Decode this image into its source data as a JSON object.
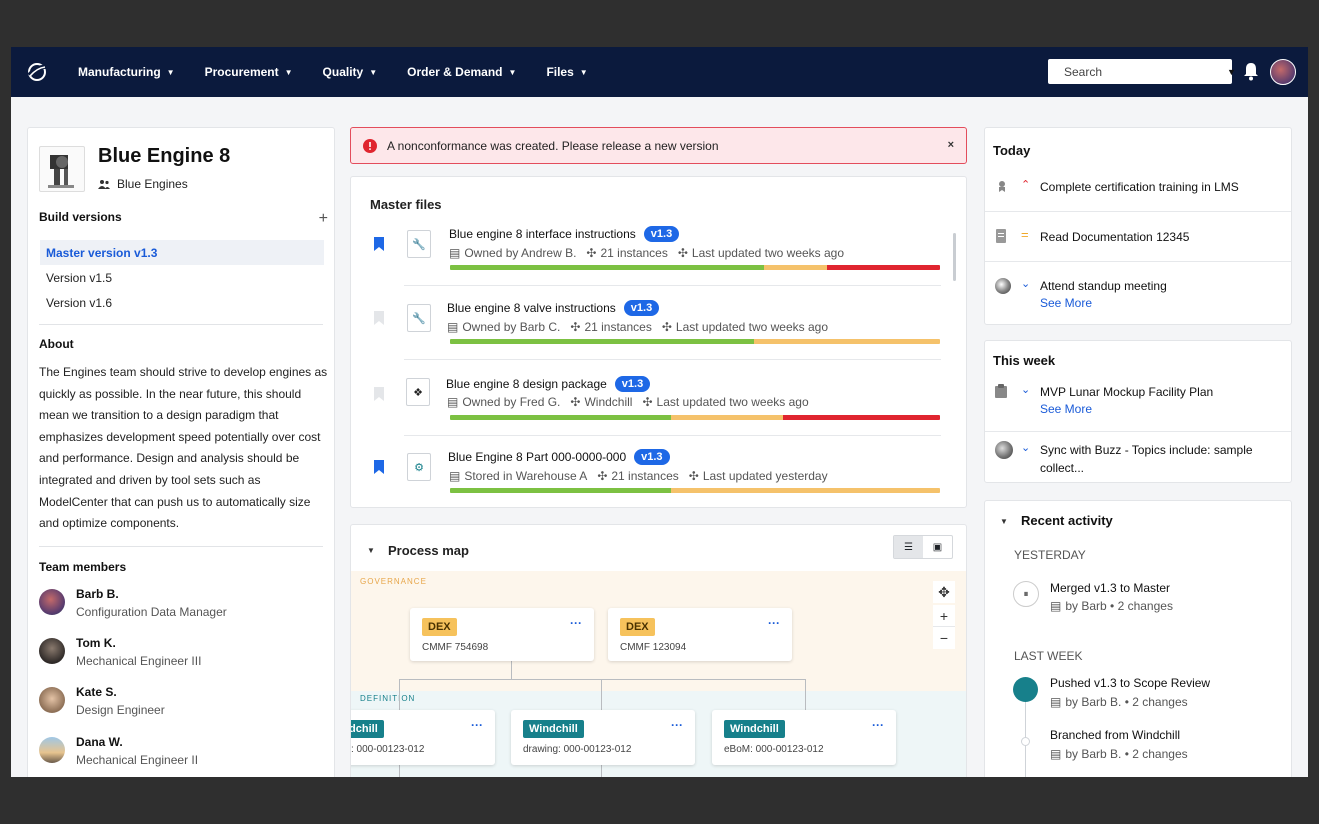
{
  "nav": {
    "menu": [
      {
        "label": "Manufacturing"
      },
      {
        "label": "Procurement"
      },
      {
        "label": "Quality"
      },
      {
        "label": "Order & Demand"
      },
      {
        "label": "Files"
      }
    ],
    "search_placeholder": "Search"
  },
  "product": {
    "title": "Blue Engine 8",
    "team": "Blue Engines",
    "build_versions_label": "Build versions",
    "versions": [
      {
        "label": "Master version v1.3",
        "active": true
      },
      {
        "label": "Version v1.5"
      },
      {
        "label": "Version v1.6"
      }
    ],
    "about_label": "About",
    "about_text": "The Engines team should strive to develop engines as quickly as possible. In the near future, this should mean we transition to a design paradigm that emphasizes development speed potentially over cost and performance. Design and analysis should be integrated and driven by tool sets such as ModelCenter that can push us to automatically size and optimize components.",
    "team_label": "Team members",
    "members": [
      {
        "name": "Barb B.",
        "role": "Configuration Data Manager"
      },
      {
        "name": "Tom K.",
        "role": "Mechanical Engineer III"
      },
      {
        "name": "Kate S.",
        "role": "Design Engineer"
      },
      {
        "name": "Dana W.",
        "role": "Mechanical Engineer II"
      }
    ]
  },
  "alert": {
    "text": "A nonconformance was created. Please release a new version",
    "close": "×"
  },
  "master_files": {
    "title": "Master files",
    "files": [
      {
        "title": "Blue engine 8 interface instructions",
        "version": "v1.3",
        "owner": "Owned by Andrew B.",
        "instances": "21 instances",
        "updated": "Last updated two weeks ago",
        "bookmarked": true,
        "progress": {
          "green": 0.64,
          "yellow": 0.13,
          "red": 0.23
        }
      },
      {
        "title": "Blue engine 8 valve instructions",
        "version": "v1.3",
        "owner": "Owned by Barb C.",
        "instances": "21 instances",
        "updated": "Last updated two weeks ago",
        "bookmarked": false,
        "progress": {
          "green": 0.62,
          "yellow": 0.38,
          "red": 0
        }
      },
      {
        "title": "Blue engine 8 design package",
        "version": "v1.3",
        "owner": "Owned by Fred G.",
        "instances": "Windchill",
        "updated": "Last updated two weeks ago",
        "bookmarked": false,
        "progress": {
          "green": 0.45,
          "yellow": 0.23,
          "red": 0.32
        }
      },
      {
        "title": "Blue Engine 8 Part 000-0000-000",
        "version": "v1.3",
        "owner": "Stored in Warehouse A",
        "instances": "21 instances",
        "updated": "Last updated yesterday",
        "bookmarked": true,
        "progress": {
          "green": 0.45,
          "yellow": 0.55,
          "red": 0
        }
      }
    ]
  },
  "process_map": {
    "title": "Process map",
    "zones": {
      "governance": "GOVERNANCE",
      "definition": "DEFINITION"
    },
    "gov_nodes": [
      {
        "tag": "DEX",
        "value": "CMMF 754698"
      },
      {
        "tag": "DEX",
        "value": "CMMF 123094"
      }
    ],
    "def_nodes": [
      {
        "tag": "Windchill",
        "value": ": 000-00123-012"
      },
      {
        "tag": "Windchill",
        "value": "drawing: 000-00123-012"
      },
      {
        "tag": "Windchill",
        "value": "eBoM: 000-00123-012"
      }
    ],
    "node_menu": "···",
    "zoom_in": "+",
    "zoom_out": "−"
  },
  "today": {
    "title": "Today",
    "tasks": [
      {
        "text": "Complete certification training in LMS",
        "priority": "high"
      },
      {
        "text": "Read Documentation 12345",
        "priority": "medium"
      },
      {
        "text": "Attend standup meeting",
        "priority": "low",
        "see_more": "See More"
      }
    ]
  },
  "this_week": {
    "title": "This week",
    "tasks": [
      {
        "text": "MVP Lunar Mockup Facility Plan",
        "see_more": "See More"
      },
      {
        "text": "Sync with Buzz - Topics include: sample collect..."
      }
    ]
  },
  "recent": {
    "title": "Recent activity",
    "groups": [
      {
        "label": "YESTERDAY",
        "items": [
          {
            "title": "Merged v1.3 to Master",
            "meta": "by Barb •  2 changes"
          }
        ]
      },
      {
        "label": "LAST WEEK",
        "items": [
          {
            "title": "Pushed v1.3 to Scope Review",
            "meta": "by Barb B. • 2 changes"
          },
          {
            "title": "Branched from Windchill",
            "meta": "by Barb B. • 2 changes"
          }
        ]
      }
    ]
  },
  "colors": {
    "nav_bg": "#0b1a3d",
    "accent": "#1e68e6",
    "green": "#7cc142",
    "yellow": "#f5c26b",
    "red": "#e0252f",
    "teal": "#17808b",
    "dex": "#f6c25c"
  }
}
